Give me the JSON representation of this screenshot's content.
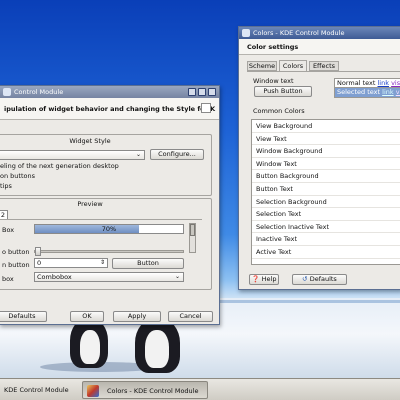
{
  "left_window": {
    "title": "Control Module",
    "header_text": "ipulation of widget behavior and changing the Style for K",
    "widget_style_label": "Widget Style",
    "style_select_value": "",
    "configure_button": "Configure...",
    "options": [
      "eling of the next generation desktop",
      "on buttons",
      "tips"
    ],
    "preview_label": "Preview",
    "tab_label": "2",
    "preview_rows": {
      "box_label": "Box",
      "progress_text": "70%",
      "progress_value": 0.7,
      "slider_label": "o button",
      "spin_label": "n button",
      "spin_value": "0",
      "button_label": "Button",
      "combo_label": "box",
      "combo_value": "Combobox"
    },
    "buttons": {
      "defaults": "Defaults",
      "ok": "OK",
      "apply": "Apply",
      "cancel": "Cancel"
    }
  },
  "right_window": {
    "title": "Colors - KDE Control Module",
    "header": "Color settings",
    "tabs": [
      "Scheme",
      "Colors",
      "Effects"
    ],
    "window_text_label": "Window text",
    "push_button_label": "Push Button",
    "preview_normal": "Normal text",
    "preview_link": "link",
    "preview_visited": "visite",
    "preview_selected": "Selected text",
    "preview_selected_link": "link",
    "preview_selected_visited": "vis",
    "common_colors_label": "Common Colors",
    "color_items": [
      "View Background",
      "View Text",
      "Window Background",
      "Window Text",
      "Button Background",
      "Button Text",
      "Selection Background",
      "Selection Text",
      "Selection Inactive Text",
      "Inactive Text",
      "Active Text"
    ],
    "help_button": "Help",
    "defaults_button": "Defaults"
  },
  "taskbar": {
    "items": [
      "KDE Control Module",
      "Colors - KDE Control Module"
    ]
  }
}
